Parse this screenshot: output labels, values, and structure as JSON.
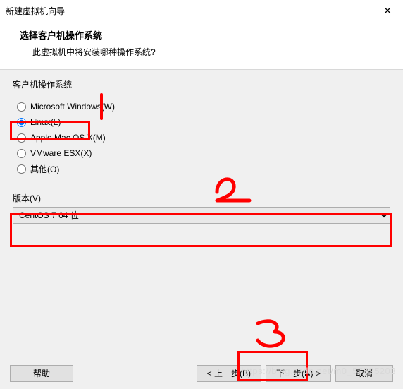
{
  "window": {
    "title": "新建虚拟机向导"
  },
  "header": {
    "title": "选择客户机操作系统",
    "subtitle": "此虚拟机中将安装哪种操作系统?"
  },
  "os_group": {
    "label": "客户机操作系统",
    "options": [
      {
        "label": "Microsoft Windows(W)",
        "checked": false
      },
      {
        "label": "Linux(L)",
        "checked": true
      },
      {
        "label": "Apple Mac OS X(M)",
        "checked": false
      },
      {
        "label": "VMware ESX(X)",
        "checked": false
      },
      {
        "label": "其他(O)",
        "checked": false
      }
    ]
  },
  "version": {
    "label": "版本(V)",
    "selected": "CentOS 7 64 位"
  },
  "buttons": {
    "help": "帮助",
    "back": "< 上一步(B)",
    "next": "下一步(N) >",
    "cancel": "取消"
  },
  "watermark": "https://blog.csdn.net/m0_57595203"
}
